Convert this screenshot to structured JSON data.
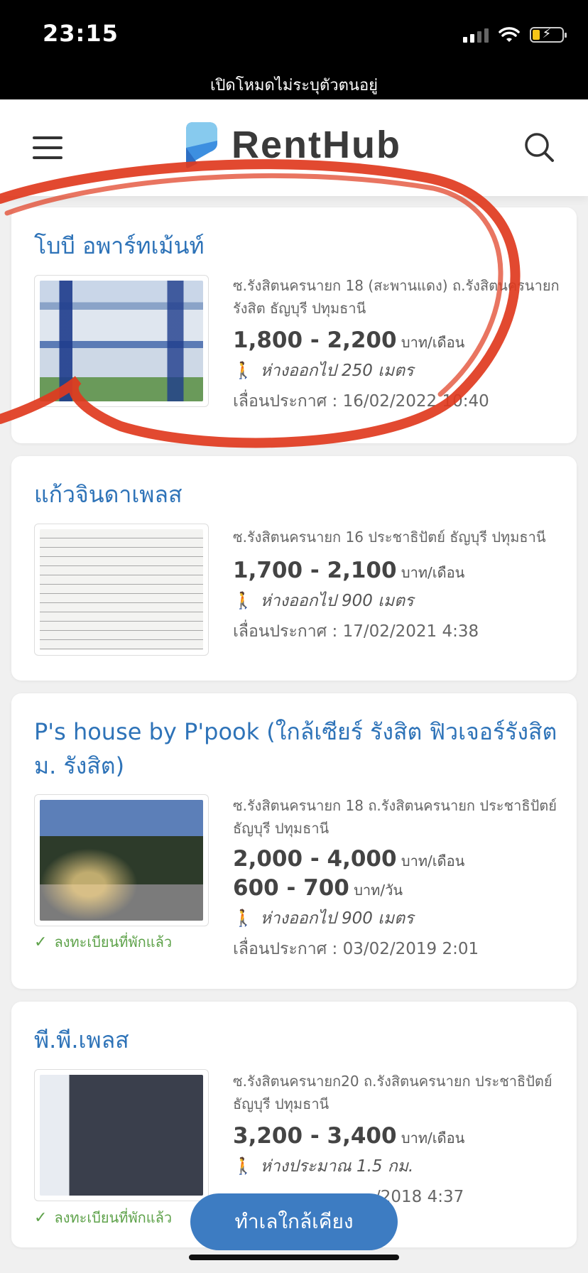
{
  "status_bar": {
    "time": "23:15",
    "private_mode_text": "เปิดโหมดไม่ระบุตัวตนอยู่",
    "signal_icon": "cellular-signal-icon",
    "wifi_icon": "wifi-icon",
    "battery_icon": "battery-charging-icon"
  },
  "header": {
    "menu_icon": "hamburger-menu-icon",
    "logo_text": "RentHub",
    "search_icon": "search-icon",
    "colors": {
      "logo_blue": "#3d8fe0",
      "logo_light": "#8fd0f0",
      "text": "#3a3a3a"
    }
  },
  "listings": [
    {
      "title": "โบบี อพาร์ทเม้นท์",
      "address": "ซ.รังสิตนครนายก 18 (สะพานแดง) ถ.รังสิตนครนายก รังสิต ธัญบุรี ปทุมธานี",
      "prices": [
        {
          "amount": "1,800 - 2,200",
          "unit": "บาท/เดือน"
        }
      ],
      "distance": "ห่างออกไป 250 เมตร",
      "posted": "เลื่อนประกาศ : 16/02/2022 10:40",
      "verified": null
    },
    {
      "title": "แก้วจินดาเพลส",
      "address": "ซ.รังสิตนครนายก 16 ประชาธิปัตย์ ธัญบุรี ปทุมธานี",
      "prices": [
        {
          "amount": "1,700 - 2,100",
          "unit": "บาท/เดือน"
        }
      ],
      "distance": "ห่างออกไป 900 เมตร",
      "posted": "เลื่อนประกาศ : 17/02/2021 4:38",
      "verified": null
    },
    {
      "title": "P's house by P'pook (ใกล้เซียร์ รังสิต ฟิวเจอร์รังสิต ม. รังสิต)",
      "address": "ซ.รังสิตนครนายก 18 ถ.รังสิตนครนายก ประชาธิปัตย์ ธัญบุรี ปทุมธานี",
      "prices": [
        {
          "amount": "2,000 - 4,000",
          "unit": "บาท/เดือน"
        },
        {
          "amount": "600 - 700",
          "unit": "บาท/วัน"
        }
      ],
      "distance": "ห่างออกไป 900 เมตร",
      "posted": "เลื่อนประกาศ : 03/02/2019 2:01",
      "verified": "ลงทะเบียนที่พักแล้ว"
    },
    {
      "title": "พี.พี.เพลส",
      "address": "ซ.รังสิตนครนายก20 ถ.รังสิตนครนายก ประชาธิปัตย์ ธัญบุรี ปทุมธานี",
      "prices": [
        {
          "amount": "3,200 - 3,400",
          "unit": "บาท/เดือน"
        }
      ],
      "distance": "ห่างประมาณ 1.5 กม.",
      "posted": "/2018 4:37",
      "verified": "ลงทะเบียนที่พักแล้ว"
    }
  ],
  "icons": {
    "walk": "walking-person-icon",
    "verified": "check-icon"
  },
  "floating_button": {
    "label": "ทำเลใกล้เคียง"
  },
  "annotation": {
    "color": "#e03a1e"
  },
  "colors": {
    "title_blue": "#2e73b8",
    "verified_green": "#5ea24a",
    "button_blue": "#3d7cc2"
  }
}
